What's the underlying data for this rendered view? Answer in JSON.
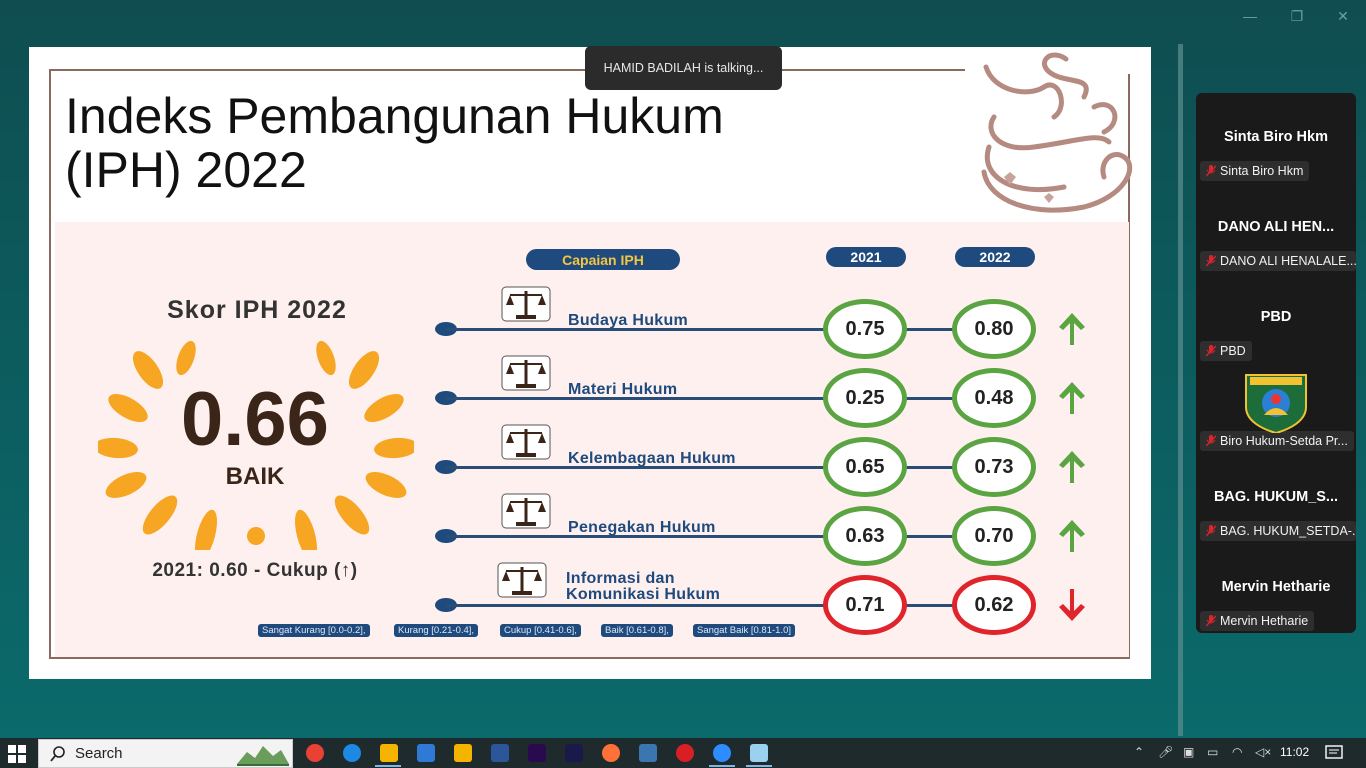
{
  "meeting": {
    "talking_banner": "HAMID BADILAH is talking..."
  },
  "slide": {
    "title_line1": "Indeks Pembangunan Hukum",
    "title_line2": "(IPH) 2022",
    "skor_title": "Skor IPH 2022",
    "score": "0.66",
    "score_label": "BAIK",
    "previous": "2021: 0.60 - Cukup (↑)",
    "header_capaian": "Capaian IPH",
    "header_2021": "2021",
    "header_2022": "2022",
    "rows": [
      {
        "label": "Budaya Hukum",
        "v2021": "0.75",
        "v2022": "0.80",
        "trend": "up",
        "icon": "scales-icon"
      },
      {
        "label": "Materi Hukum",
        "v2021": "0.25",
        "v2022": "0.48",
        "trend": "up",
        "icon": "law-document-icon"
      },
      {
        "label": "Kelembagaan Hukum",
        "v2021": "0.65",
        "v2022": "0.73",
        "trend": "up",
        "icon": "institution-building-icon"
      },
      {
        "label": "Penegakan Hukum",
        "v2021": "0.63",
        "v2022": "0.70",
        "trend": "up",
        "icon": "justice-shield-icon"
      },
      {
        "label": "Informasi dan",
        "label2": "Komunikasi Hukum",
        "v2021": "0.71",
        "v2022": "0.62",
        "trend": "down",
        "icon": "gavel-globe-icon"
      }
    ],
    "legend": [
      "Sangat Kurang [0.0-0.2],",
      "Kurang [0.21-0.4],",
      "Cukup [0.41-0.6],",
      "Baik [0.61-0.8],",
      "Sangat Baik [0.81-1.0]"
    ],
    "colors": {
      "up": "#5aa442",
      "down": "#e0242c",
      "navy": "#1f4a7e",
      "laurel": "#f6a623"
    }
  },
  "participants": [
    {
      "name_big": "Sinta Biro Hkm",
      "tag": "Sinta Biro Hkm"
    },
    {
      "name_big": "DANO ALI HEN...",
      "tag": "DANO ALI HENALALE..."
    },
    {
      "name_big": "PBD",
      "tag": "PBD"
    },
    {
      "name_big": "",
      "tag": "Biro Hukum-Setda Pr..."
    },
    {
      "name_big": "BAG. HUKUM_S...",
      "tag": "BAG. HUKUM_SETDA-..."
    },
    {
      "name_big": "Mervin Hetharie",
      "tag": "Mervin Hetharie"
    }
  ],
  "taskbar": {
    "search_label": "Search",
    "clock": "11:02",
    "apps": [
      "chrome-icon",
      "edge-icon",
      "file-explorer-icon",
      "store-icon",
      "media-player-icon",
      "word-icon",
      "premiere-icon",
      "after-effects-icon",
      "firefox-icon",
      "python-icon",
      "opera-icon",
      "zoom-icon",
      "notepad-icon"
    ]
  }
}
